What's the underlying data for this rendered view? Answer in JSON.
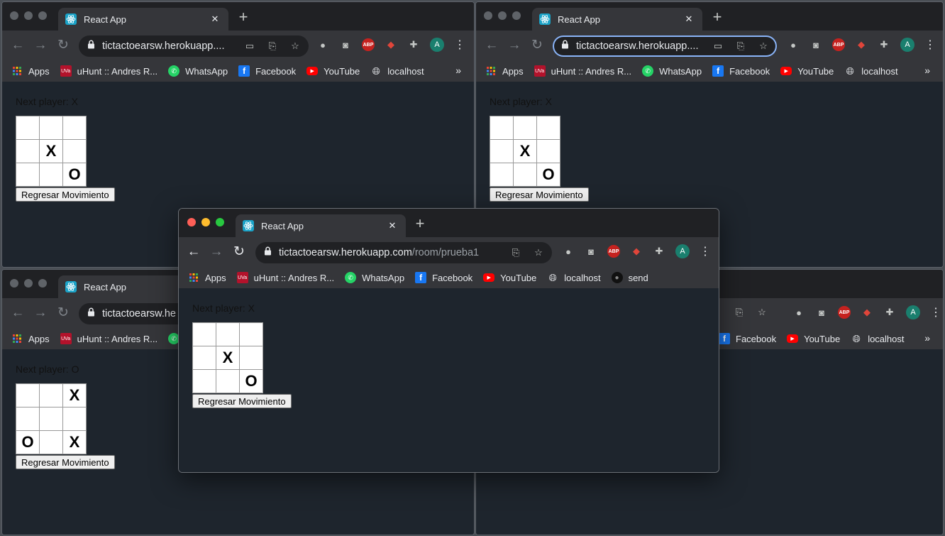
{
  "app": {
    "tab_title": "React App",
    "new_tab_glyph": "+",
    "close_glyph": "✕",
    "nav": {
      "back": "←",
      "forward": "→",
      "reload": "↻"
    },
    "lock_glyph": "🔒",
    "url_host_truncated": "tictactoearsw.herokuapp....",
    "url_host_cut": "tictactoearsw.he",
    "url_host": "tictactoearsw.herokuapp.com",
    "url_path": "/room/prueba1",
    "avatar_letter": "A",
    "abp_label": "ABP",
    "kebab": "⋮",
    "bookmarks": [
      {
        "label": "Apps",
        "icon": "apps-grid-icon"
      },
      {
        "label": "uHunt :: Andres R...",
        "icon": "uva-icon"
      },
      {
        "label": "WhatsApp",
        "icon": "whatsapp-icon"
      },
      {
        "label": "Facebook",
        "icon": "facebook-icon"
      },
      {
        "label": "YouTube",
        "icon": "youtube-icon"
      },
      {
        "label": "localhost",
        "icon": "globe-icon"
      },
      {
        "label": "send",
        "icon": "github-icon"
      }
    ],
    "bookmarks_more": "»",
    "colors": {
      "content_bg": "#1e252d",
      "chrome_frame": "#202124",
      "toolbar": "#35363a",
      "focus_ring": "#8ab4f8"
    }
  },
  "windows": {
    "top_left": {
      "status": "Next player: X",
      "board": [
        "",
        "",
        "",
        "",
        "X",
        "",
        "",
        "",
        "O"
      ],
      "undo_label": "Regresar Movimiento"
    },
    "top_right": {
      "status": "Next player: X",
      "board": [
        "",
        "",
        "",
        "",
        "X",
        "",
        "",
        "",
        "O"
      ],
      "undo_label": "Regresar Movimiento"
    },
    "bottom_left": {
      "status": "Next player: O",
      "board": [
        "",
        "",
        "X",
        "",
        "",
        "",
        "O",
        "",
        "X"
      ],
      "undo_label": "Regresar Movimiento"
    },
    "front": {
      "status": "Next player: X",
      "board": [
        "",
        "",
        "",
        "",
        "X",
        "",
        "",
        "",
        "O"
      ],
      "undo_label": "Regresar Movimiento"
    }
  }
}
